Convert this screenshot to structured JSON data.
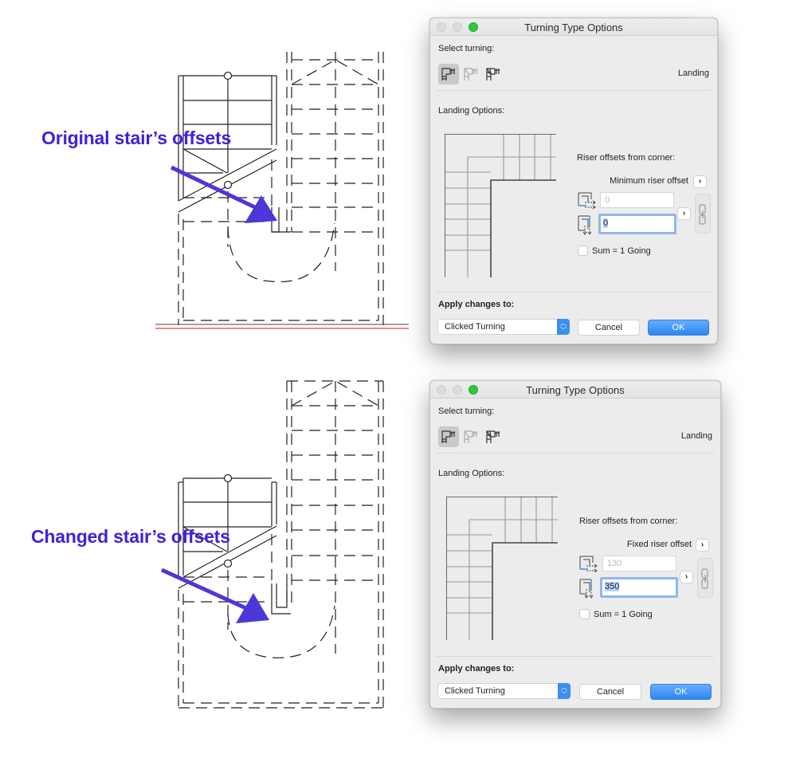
{
  "annotations": {
    "top": "Original stair’s offsets",
    "bottom": "Changed stair’s offsets",
    "arrow_color": "#4a38d8"
  },
  "dialogs": [
    {
      "title": "Turning Type Options",
      "select_turning_label": "Select turning:",
      "turning_types": [
        {
          "icon": "landing-turning-icon",
          "active": true
        },
        {
          "icon": "winder-turning-icon",
          "active": false
        },
        {
          "icon": "spiral-winder-turning-icon",
          "active": false
        }
      ],
      "turning_type_value": "Landing",
      "landing_options_label": "Landing Options:",
      "riser_offsets_label": "Riser offsets from corner:",
      "offset_mode": "Minimum riser offset",
      "offset_1_value": "0",
      "offset_2_value": "0",
      "sum_checkbox_label": "Sum = 1 Going",
      "sum_checked": false,
      "apply_label": "Apply changes to:",
      "apply_select_value": "Clicked Turning",
      "cancel_label": "Cancel",
      "ok_label": "OK"
    },
    {
      "title": "Turning Type Options",
      "select_turning_label": "Select turning:",
      "turning_types": [
        {
          "icon": "landing-turning-icon",
          "active": true
        },
        {
          "icon": "winder-turning-icon",
          "active": false
        },
        {
          "icon": "spiral-winder-turning-icon",
          "active": false
        }
      ],
      "turning_type_value": "Landing",
      "landing_options_label": "Landing Options:",
      "riser_offsets_label": "Riser offsets from corner:",
      "offset_mode": "Fixed riser offset",
      "offset_1_value": "130",
      "offset_2_value": "350",
      "sum_checkbox_label": "Sum = 1 Going",
      "sum_checked": false,
      "apply_label": "Apply changes to:",
      "apply_select_value": "Clicked Turning",
      "cancel_label": "Cancel",
      "ok_label": "OK"
    }
  ]
}
